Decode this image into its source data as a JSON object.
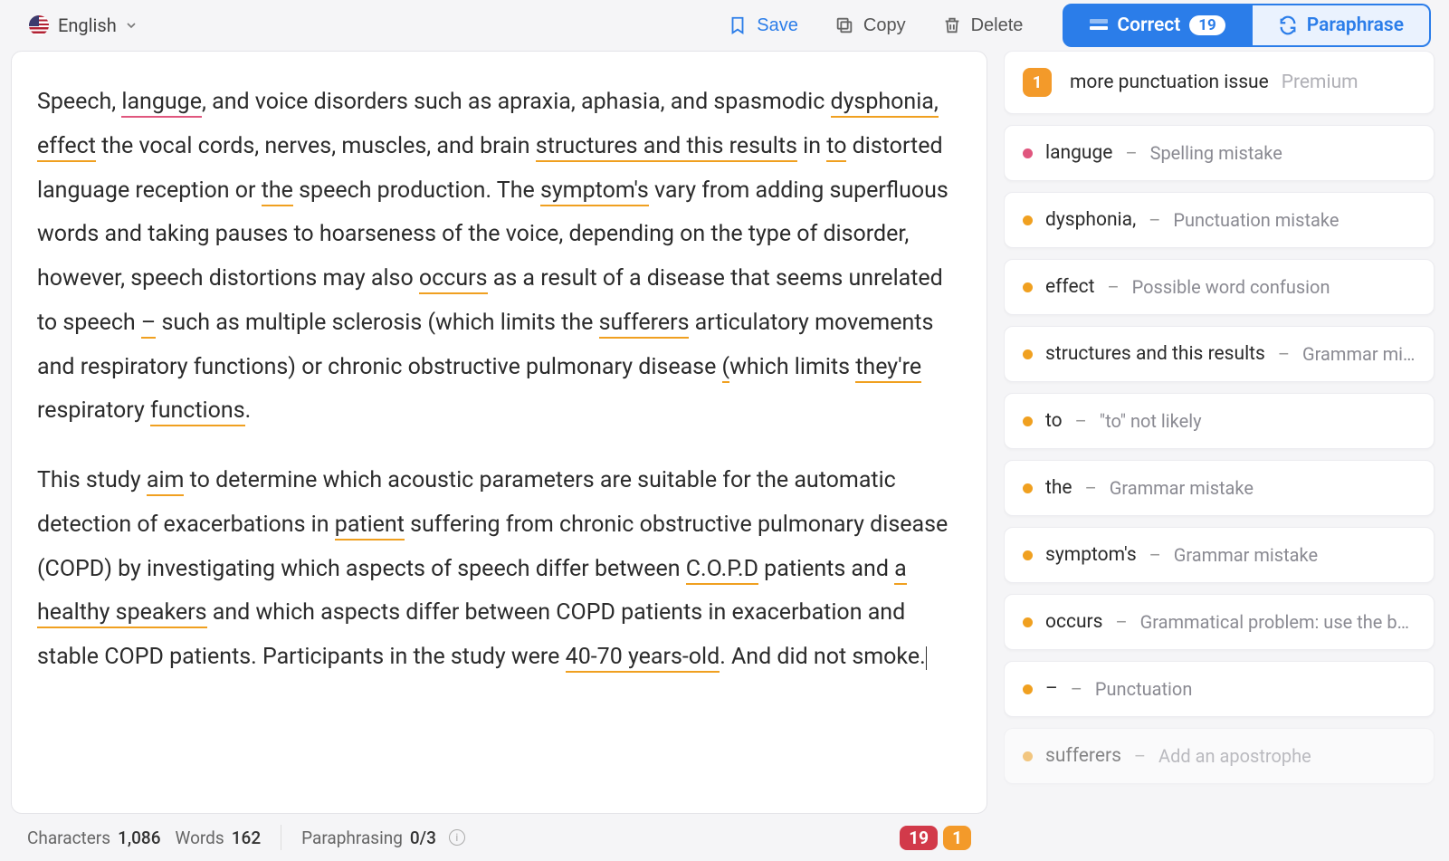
{
  "toolbar": {
    "language": "English",
    "save": "Save",
    "copy": "Copy",
    "delete": "Delete",
    "correct": "Correct",
    "correct_count": "19",
    "paraphrase": "Paraphrase"
  },
  "editor": {
    "p1": {
      "t1": "Speech, ",
      "languge": "languge",
      "t2": ", and voice disorders such as apraxia, aphasia, and spasmodic ",
      "dysphonia": "dysphonia,",
      "t3": " ",
      "effect": "effect",
      "t4": " the vocal cords, nerves, muscles, and brain ",
      "structures": "structures and this results",
      "t5": " in ",
      "to": "to",
      "t6": " distorted language reception or ",
      "the": "the",
      "t7": " speech production. The ",
      "symptoms": "symptom's",
      "t8": " vary from adding superfluous words and taking pauses to hoarseness of the voice, depending on the type of disorder, however, speech distortions may also ",
      "occurs": "occurs",
      "t9": " as a result of a disease that seems unrelated to speech ",
      "dash": "–",
      "t10": " such as multiple sclerosis (which limits the ",
      "sufferers": "sufferers",
      "t11": " articulatory movements and respiratory functions) or chronic obstructive pulmonary disease ",
      "paren": "(",
      "t12": "which limits ",
      "theyre": "they're",
      "t13": " respiratory ",
      "functions": "functions",
      "t14": "."
    },
    "p2": {
      "t1": "This study ",
      "aim": "aim",
      "t2": " to determine which acoustic parameters are suitable for the automatic detection of exacerbations in ",
      "patient": "patient",
      "t3": " suffering from chronic obstructive pulmonary disease (COPD) by investigating which aspects of speech differ between ",
      "copd": "C.O.P.D",
      "t4": " patients and ",
      "healthy": "a healthy speakers",
      "t5": " and which aspects differ between COPD patients in exacerbation and stable COPD patients. Participants in the study were ",
      "age": "40-70 years-old",
      "t6": ". And did not smoke."
    }
  },
  "issues": {
    "premium": {
      "count": "1",
      "text": "more punctuation issue",
      "label": "Premium"
    },
    "list": [
      {
        "dot": "pink",
        "term": "languge",
        "msg": "Spelling mistake"
      },
      {
        "dot": "amber",
        "term": "dysphonia,",
        "msg": "Punctuation mistake"
      },
      {
        "dot": "amber",
        "term": "effect",
        "msg": "Possible word confusion"
      },
      {
        "dot": "amber",
        "term": "structures and this results",
        "msg": "Grammar mi…"
      },
      {
        "dot": "amber",
        "term": "to",
        "msg": "\"to\" not likely"
      },
      {
        "dot": "amber",
        "term": "the",
        "msg": "Grammar mistake"
      },
      {
        "dot": "amber",
        "term": "symptom's",
        "msg": "Grammar mistake"
      },
      {
        "dot": "amber",
        "term": "occurs",
        "msg": "Grammatical problem: use the bas…"
      },
      {
        "dot": "amber",
        "term": "–",
        "msg": "Punctuation"
      },
      {
        "dot": "amber",
        "term": "sufferers",
        "msg": "Add an apostrophe",
        "faded": true
      }
    ]
  },
  "status": {
    "chars_label": "Characters",
    "chars": "1,086",
    "words_label": "Words",
    "words": "162",
    "para_label": "Paraphrasing",
    "para": "0/3",
    "badge_red": "19",
    "badge_orange": "1"
  }
}
